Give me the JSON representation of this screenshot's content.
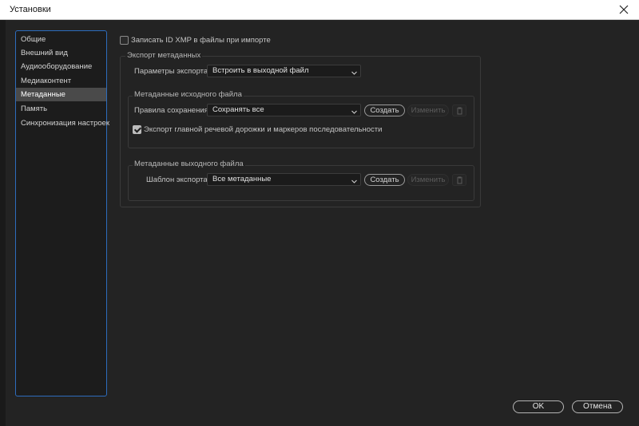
{
  "window": {
    "title": "Установки"
  },
  "sidebar": {
    "items": [
      {
        "label": "Общие",
        "active": false
      },
      {
        "label": "Внешний вид",
        "active": false
      },
      {
        "label": "Аудиооборудование",
        "active": false
      },
      {
        "label": "Медиаконтент",
        "active": false
      },
      {
        "label": "Метаданные",
        "active": true
      },
      {
        "label": "Память",
        "active": false
      },
      {
        "label": "Синхронизация настроек",
        "active": false
      }
    ]
  },
  "metadata": {
    "xmp_checkbox": {
      "label": "Записать ID XMP в файлы при импорте",
      "checked": false
    },
    "export_group": {
      "title": "Экспорт метаданных",
      "params_label": "Параметры экспорта:",
      "params_value": "Встроить в выходной файл",
      "source_group": {
        "title": "Метаданные исходного файла",
        "rules_label": "Правила сохранения:",
        "rules_value": "Сохранять все",
        "create_label": "Создать",
        "edit_label": "Изменить",
        "speech_checkbox": {
          "label": "Экспорт главной речевой дорожки и маркеров последовательности",
          "checked": true
        }
      },
      "output_group": {
        "title": "Метаданные выходного файла",
        "template_label": "Шаблон экспорта:",
        "template_value": "Все метаданные",
        "create_label": "Создать",
        "edit_label": "Изменить"
      }
    }
  },
  "footer": {
    "ok_label": "OK",
    "cancel_label": "Отмена"
  },
  "icons": {
    "close": "close-icon",
    "trash": "trash-icon",
    "dropdown": "chevron-down-icon",
    "check": "checkmark-icon"
  },
  "colors": {
    "accent_border": "#2d6cbd",
    "active_item": "#4a4a4a",
    "background": "#232323"
  }
}
